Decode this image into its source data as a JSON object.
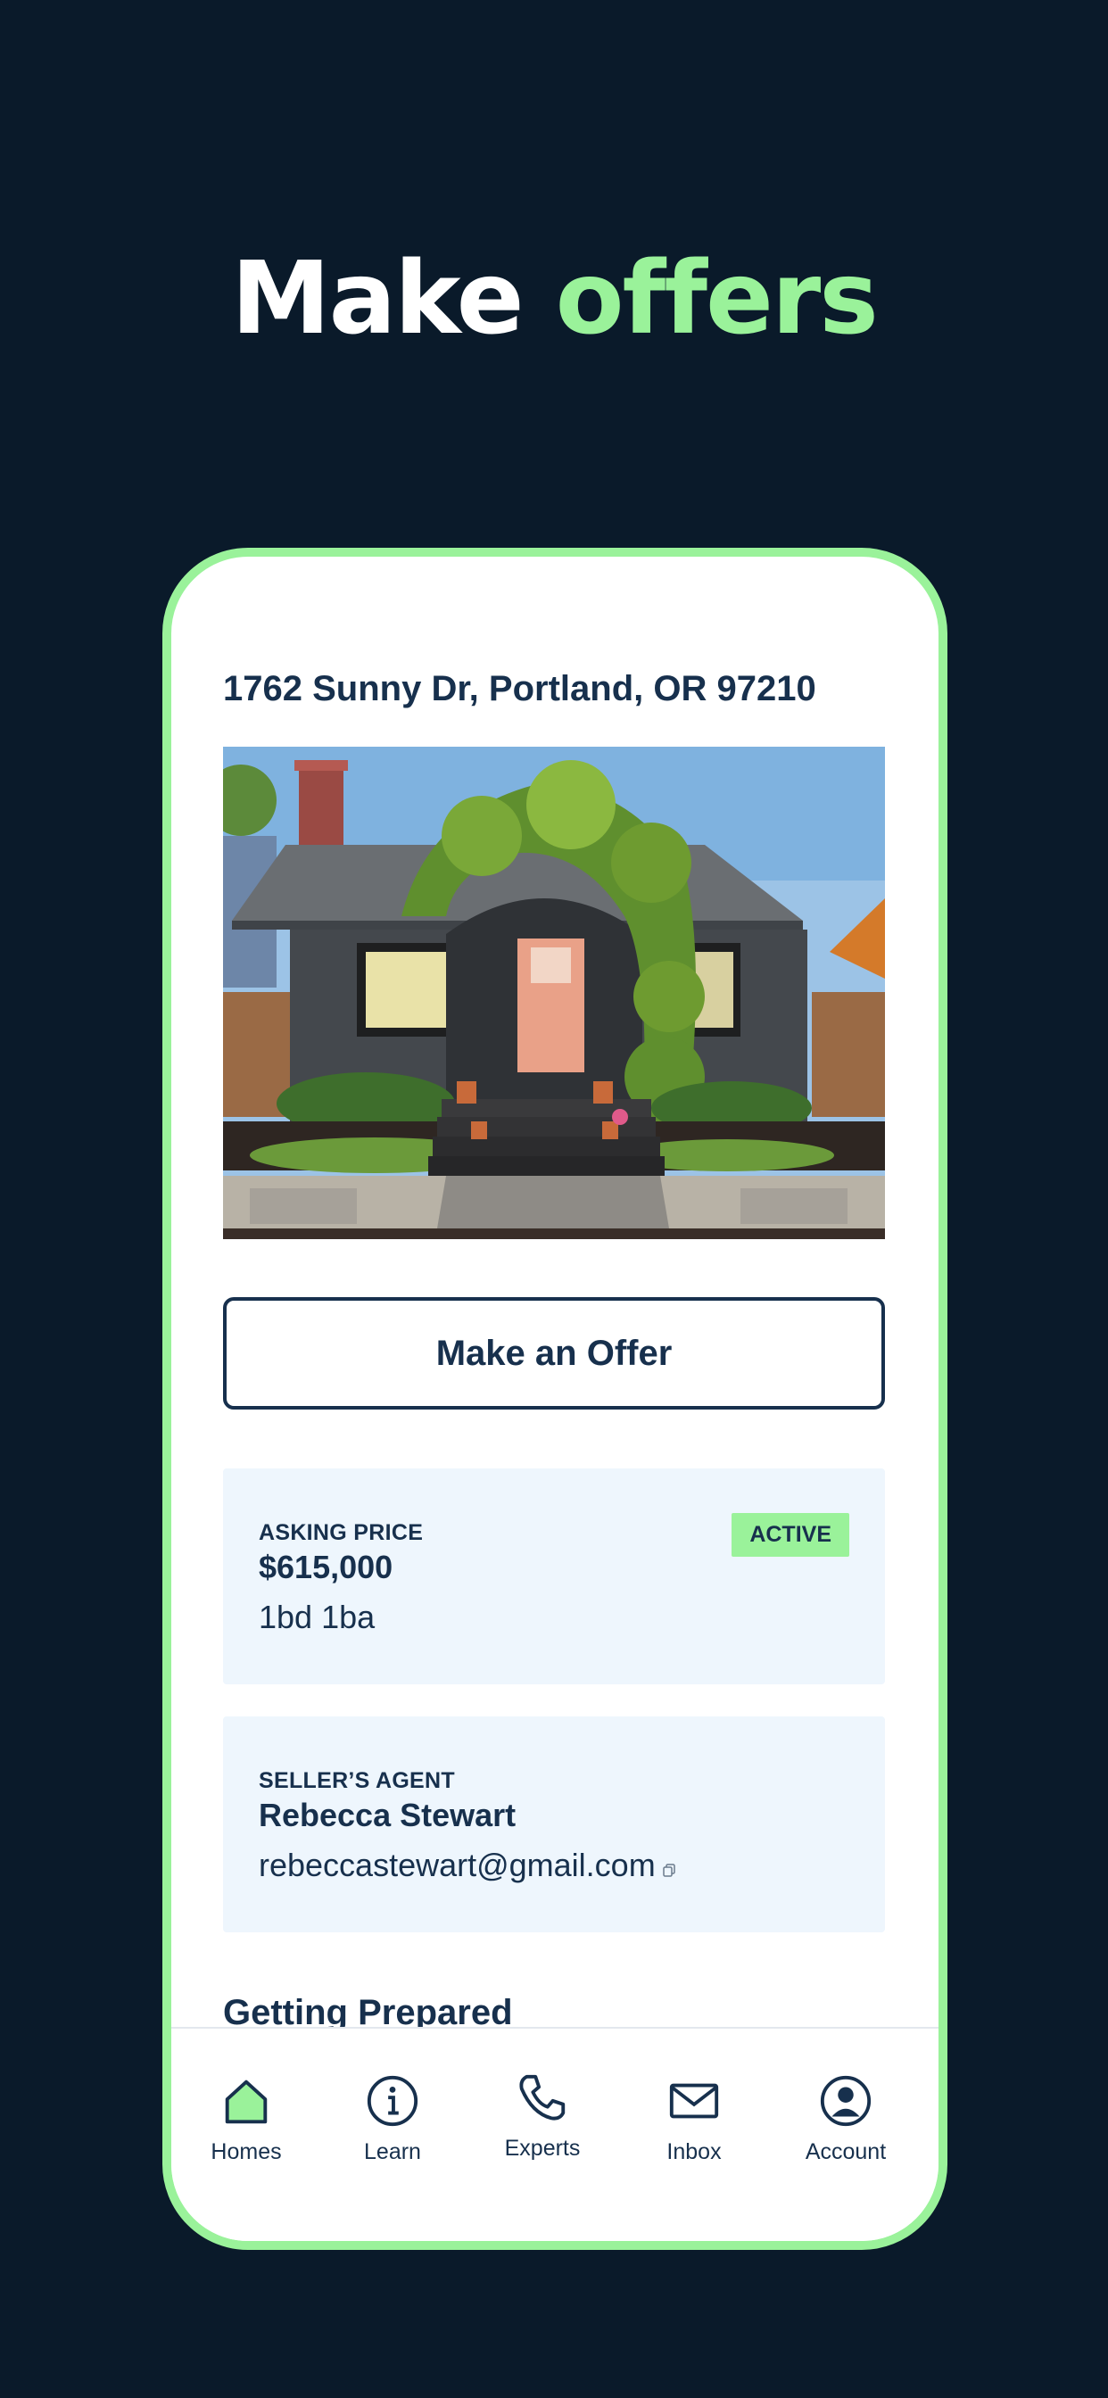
{
  "headline": {
    "part1": "Make",
    "part2": "offers"
  },
  "listing": {
    "address": "1762 Sunny Dr, Portland, OR 97210",
    "photo_alt": "house-photo"
  },
  "actions": {
    "make_offer_label": "Make an Offer"
  },
  "price_card": {
    "label": "ASKING PRICE",
    "price": "$615,000",
    "beds_baths": "1bd 1ba",
    "status": "ACTIVE"
  },
  "agent_card": {
    "label": "SELLER’S AGENT",
    "name": "Rebecca Stewart",
    "email": "rebeccastewart@gmail.com"
  },
  "sections": {
    "getting_prepared": "Getting Prepared"
  },
  "tabbar": {
    "items": [
      {
        "label": "Homes",
        "icon": "home-icon",
        "active": true
      },
      {
        "label": "Learn",
        "icon": "info-icon",
        "active": false
      },
      {
        "label": "Experts",
        "icon": "phone-icon",
        "active": false
      },
      {
        "label": "Inbox",
        "icon": "mail-icon",
        "active": false
      },
      {
        "label": "Account",
        "icon": "account-icon",
        "active": false
      }
    ]
  },
  "colors": {
    "background": "#0a1a2a",
    "accent": "#9af29a",
    "navy": "#17304d",
    "card": "#eef6fd"
  }
}
